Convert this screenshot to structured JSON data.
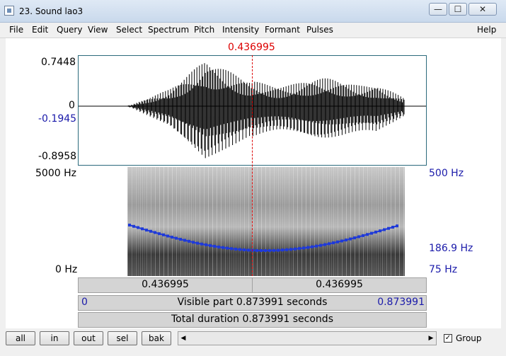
{
  "window": {
    "title": "23. Sound lao3",
    "minimize": "—",
    "maximize": "☐",
    "close": "✕"
  },
  "menu": [
    "File",
    "Edit",
    "Query",
    "View",
    "Select",
    "Spectrum",
    "Pitch",
    "Intensity",
    "Formant",
    "Pulses",
    "Help"
  ],
  "cursor": {
    "time_label": "0.436995",
    "position_fraction": 0.5
  },
  "waveform": {
    "max_label": "0.7448",
    "zero_label": "0",
    "cursor_value_label": "-0.1945",
    "min_label": "-0.8958"
  },
  "spectrogram": {
    "freq_top_label": "5000 Hz",
    "freq_bottom_label": "0 Hz",
    "pitch_top_label": "500 Hz",
    "pitch_cursor_label": "186.9 Hz",
    "pitch_bottom_label": "75 Hz"
  },
  "timebar": {
    "left_segment": "0.436995",
    "right_segment": "0.436995",
    "start": "0",
    "visible_part": "Visible part 0.873991 seconds",
    "end": "0.873991",
    "total_duration": "Total duration 0.873991 seconds"
  },
  "toolbar": {
    "all": "all",
    "in": "in",
    "out": "out",
    "sel": "sel",
    "bak": "bak",
    "group_label": "Group",
    "group_checked": true
  },
  "colors": {
    "accent_red": "#dd0000",
    "label_blue": "#1a1aaa",
    "pitch_blue": "#1f3ad8"
  }
}
